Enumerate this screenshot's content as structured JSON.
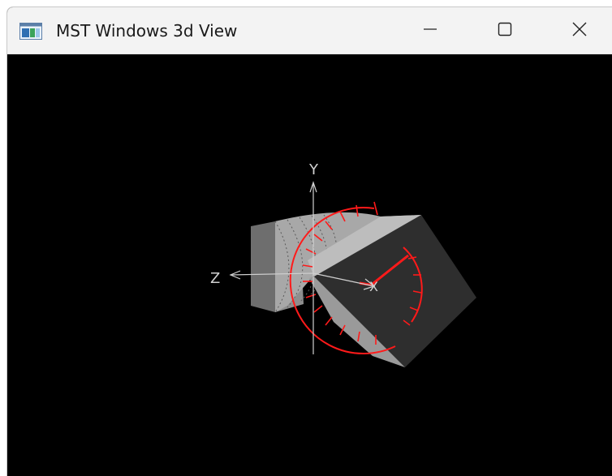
{
  "window": {
    "title": "MST Windows 3d View",
    "icon": "app-window-icon",
    "controls": {
      "minimize_icon": "minimize-icon",
      "maximize_icon": "maximize-icon",
      "close_icon": "close-icon"
    }
  },
  "viewport": {
    "background": "#000000",
    "axes": {
      "y_label": "Y",
      "z_label": "Z",
      "x_label": "X"
    },
    "colors": {
      "model": "#8a8a8a",
      "grid_overlay": "#ff1a1a",
      "axes": "#d0d0d0"
    }
  }
}
